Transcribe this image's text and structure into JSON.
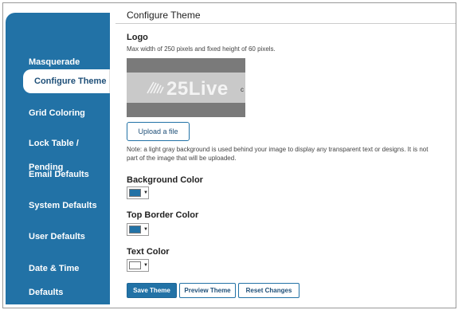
{
  "sidebar": {
    "items": [
      {
        "label": "Masquerade"
      },
      {
        "label": "Configure Theme"
      },
      {
        "label": "Grid Coloring"
      },
      {
        "label": "Lock Table / Pending"
      },
      {
        "label": "Email Defaults"
      },
      {
        "label": "System Defaults"
      },
      {
        "label": "User Defaults"
      },
      {
        "label": "Date & Time Defaults"
      }
    ],
    "active": "Configure Theme",
    "color": "#2272a6"
  },
  "main": {
    "title": "Configure Theme",
    "logo": {
      "label": "Logo",
      "hint": "Max width of 250 pixels and fixed height of 60 pixels.",
      "logo_text": "25Live",
      "logo_cursor": "c"
    },
    "upload_label": "Upload a file",
    "note_line1": "Note: a light gray background is used behind your image to display any transparent text or designs. It is not",
    "note_line2": "part of the image that will be uploaded.",
    "background_color": {
      "label": "Background Color",
      "value": "#2272a6"
    },
    "top_border_color": {
      "label": "Top Border Color",
      "value": "#2272a6"
    },
    "text_color": {
      "label": "Text Color",
      "value": "#ffffff"
    },
    "caret": "▼",
    "buttons": {
      "save": "Save Theme",
      "preview": "Preview Theme",
      "reset": "Reset Changes"
    }
  }
}
